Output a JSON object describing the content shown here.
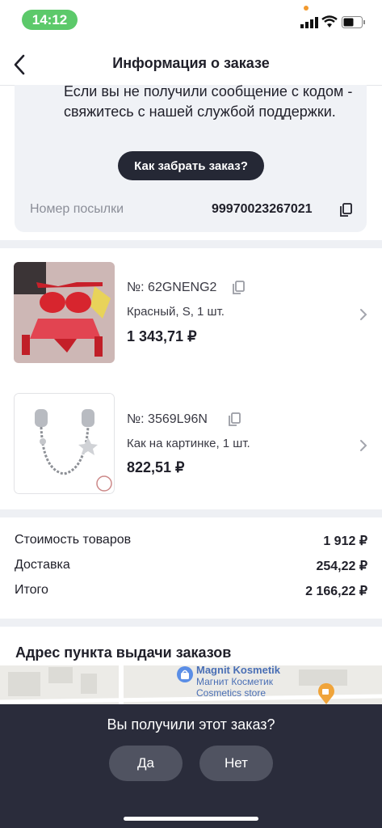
{
  "status": {
    "time": "14:12"
  },
  "header": {
    "title": "Информация о заказе"
  },
  "notice": {
    "text": "Если вы не получили сообщение с кодом - свяжитесь с нашей службой поддержки.",
    "button": "Как забрать заказ?",
    "tracking_label": "Номер посылки",
    "tracking_number": "99970023267021"
  },
  "items": [
    {
      "sku": "№: 62GNENG2",
      "variant": "Красный, S, 1 шт.",
      "price": "1 343,71 ₽"
    },
    {
      "sku": "№: 3569L96N",
      "variant": "Как на картинке, 1 шт.",
      "price": "822,51 ₽"
    }
  ],
  "summary": {
    "goods_label": "Стоимость товаров",
    "goods_value": "1 912 ₽",
    "delivery_label": "Доставка",
    "delivery_value": "254,22 ₽",
    "total_label": "Итого",
    "total_value": "2 166,22 ₽"
  },
  "address": {
    "title": "Адрес пункта выдачи заказов",
    "map_label_1": "Magnit Kosmetik",
    "map_label_2": "Магнит Косметик",
    "map_label_3": "Cosmetics store"
  },
  "prompt": {
    "question": "Вы получили этот заказ?",
    "yes": "Да",
    "no": "Нет"
  },
  "colors": {
    "dark": "#252835",
    "overlay": "#2a2c3b",
    "pill": "#505361",
    "time_pill": "#5cc96a"
  }
}
